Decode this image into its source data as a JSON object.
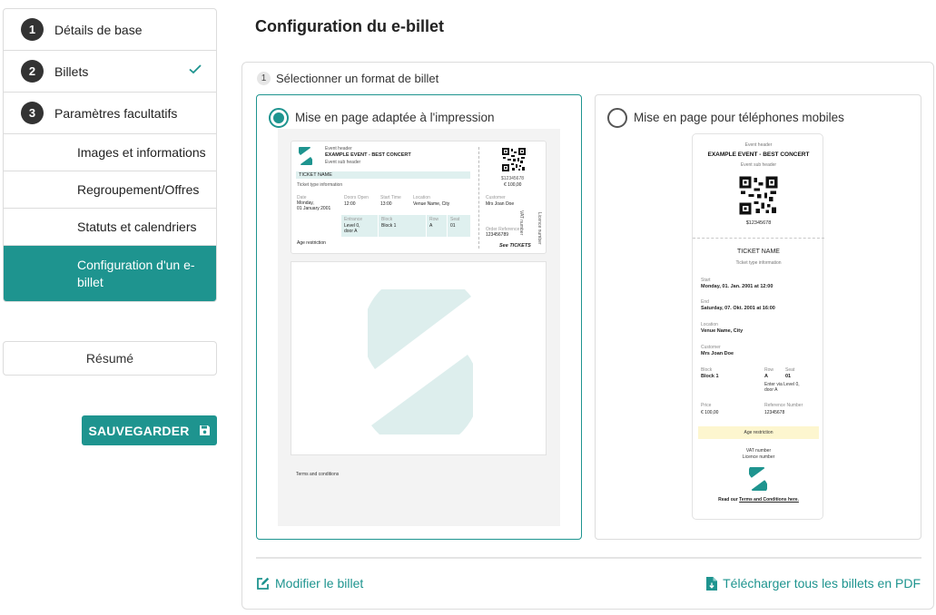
{
  "sidebar": {
    "steps": [
      {
        "num": "1",
        "label": "Détails de base"
      },
      {
        "num": "2",
        "label": "Billets"
      },
      {
        "num": "3",
        "label": "Paramètres facultatifs"
      }
    ],
    "subitems": [
      {
        "label": "Images et informations"
      },
      {
        "label": "Regroupement/Offres"
      },
      {
        "label": "Statuts et calendriers"
      },
      {
        "label": "Configuration d'un e-billet"
      }
    ],
    "resume": "Résumé",
    "save": "SAUVEGARDER"
  },
  "main": {
    "title": "Configuration du e-billet",
    "step": {
      "num": "1",
      "label": "Sélectionner un format de billet"
    },
    "options": [
      {
        "label": "Mise en page adaptée à l'impression",
        "selected": true
      },
      {
        "label": "Mise en page pour téléphones mobiles",
        "selected": false
      }
    ],
    "edit_link": "Modifier le billet",
    "download_link": "Télécharger tous les billets en PDF"
  },
  "print_ticket": {
    "event_header": "Event header",
    "event_title": "EXAMPLE EVENT - BEST CONCERT",
    "event_subheader": "Event sub header",
    "ticket_name": "TICKET NAME",
    "ticket_type": "Ticket type information",
    "date_label": "Date",
    "date_value": "Monday,",
    "date_value2": "01 January 2001",
    "doors_label": "Doors Open",
    "doors_value": "12:00",
    "start_label": "Start Time",
    "start_value": "13:00",
    "location_label": "Location",
    "location_value": "Venue Name, City",
    "entrance_label": "Entrance",
    "entrance_value": "Level 0,",
    "entrance_value2": "door A",
    "block_label": "Block",
    "block_value": "Block 1",
    "row_label": "Row",
    "row_value": "A",
    "seat_label": "Seat",
    "seat_value": "01",
    "age": "Age restriction",
    "code": "$12345678",
    "price": "€ 100,00",
    "customer_label": "Customer",
    "customer_value": "Mrs Joan Doe",
    "order_label": "Order Reference",
    "order_value": "123456789",
    "vat": "VAT number",
    "licence": "Licence number",
    "brand": "See TICKETS",
    "terms": "Terms and conditions"
  },
  "mobile_ticket": {
    "event_header": "Event header",
    "event_title": "EXAMPLE EVENT - BEST CONCERT",
    "event_subheader": "Event sub header",
    "code": "$12345678",
    "ticket_name": "TICKET NAME",
    "ticket_type": "Ticket type information",
    "start_label": "Start",
    "start_value": "Monday, 01. Jan. 2001 at 12:00",
    "end_label": "End",
    "end_value": "Saturday, 07. Okt. 2001 at 16:00",
    "location_label": "Location",
    "location_value": "Venue Name, City",
    "customer_label": "Customer",
    "customer_value": "Mrs Joan Doe",
    "block_label": "Block",
    "block_value": "Block 1",
    "row_label": "Row",
    "row_value": "A",
    "seat_label": "Seat",
    "seat_value": "01",
    "entrance_value": "Enter via Level 0,",
    "entrance_value2": "door A",
    "price_label": "Price",
    "price_value": "€ 100,00",
    "ref_label": "Reference Number",
    "ref_value": "12345678",
    "age": "Age restriction",
    "vat": "VAT number",
    "licence": "Licence number",
    "read": "Read our",
    "terms_link": "Terms and Conditions here."
  },
  "colors": {
    "accent": "#1e948f",
    "logo_light": "#ddeeed"
  },
  "icons": {
    "check": "check-icon",
    "save": "floppy-disk-icon",
    "edit": "pencil-square-icon",
    "download": "file-download-icon"
  }
}
